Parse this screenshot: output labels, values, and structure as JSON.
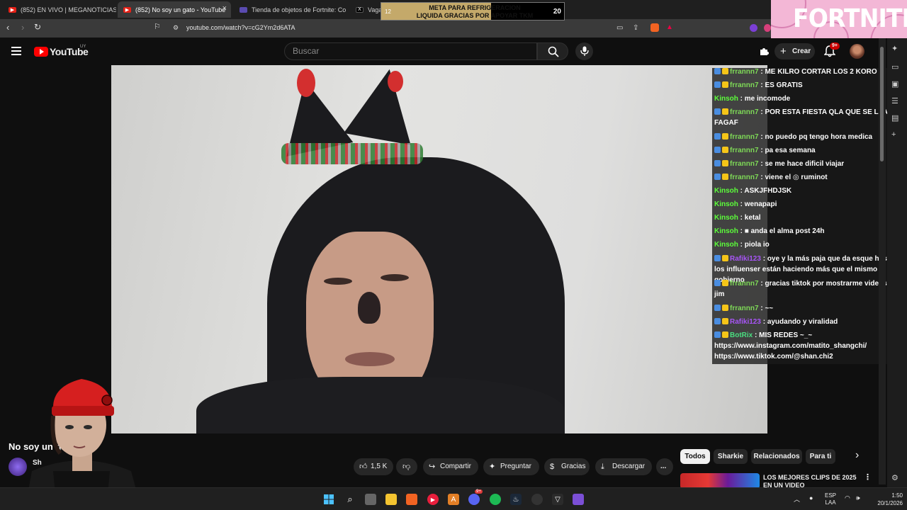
{
  "browser": {
    "tabs": [
      {
        "label": "(852) EN VIVO | MEGANOTICIAS"
      },
      {
        "label": "(852) No soy un gato - YouTube"
      },
      {
        "label": "Tienda de objetos de Fortnite: Conte"
      },
      {
        "label": "Vaga"
      }
    ],
    "tab_close": "×",
    "url": "youtube.com/watch?v=cG2Ym2d6ATA"
  },
  "overlays": {
    "goal": {
      "line1": "META PARA REFRIGERACION",
      "line2": "LIQUIDA GRACIAS POR APOYAR TKM",
      "current": "12",
      "target": "20",
      "progress": 0.6
    },
    "fortnite_logo": "FORTNITE"
  },
  "youtube": {
    "logo": "YouTube",
    "region": "UY",
    "search_placeholder": "Buscar",
    "create_label": "Crear",
    "notifications_count": "9+"
  },
  "chat": {
    "messages": [
      {
        "user": "frrannn7",
        "user_color": "#7ed957",
        "text": "ME KILRO CORTAR LOS 2 KORO"
      },
      {
        "user": "frrannn7",
        "user_color": "#7ed957",
        "text": "ES GRATIS"
      },
      {
        "user": "Kinsoh",
        "user_color": "#5cff3a",
        "text": "me incomode"
      },
      {
        "user": "frrannn7",
        "user_color": "#7ed957",
        "text": "POR ESTA FIESTA QLA QUE SE LLAMA FAGAF"
      },
      {
        "user": "frrannn7",
        "user_color": "#7ed957",
        "text": "no puedo pq tengo hora medica"
      },
      {
        "user": "frrannn7",
        "user_color": "#7ed957",
        "text": "pa esa semana"
      },
      {
        "user": "frrannn7",
        "user_color": "#7ed957",
        "text": "se me hace dificil viajar"
      },
      {
        "user": "frrannn7",
        "user_color": "#7ed957",
        "text": "viene el ◎ ruminot"
      },
      {
        "user": "Kinsoh",
        "user_color": "#5cff3a",
        "text": "ASKJFHDJSK"
      },
      {
        "user": "Kinsoh",
        "user_color": "#5cff3a",
        "text": "wenapapi"
      },
      {
        "user": "Kinsoh",
        "user_color": "#5cff3a",
        "text": "ketal"
      },
      {
        "user": "Kinsoh",
        "user_color": "#5cff3a",
        "text": "■ anda el alma post 24h"
      },
      {
        "user": "Kinsoh",
        "user_color": "#5cff3a",
        "text": "piola io"
      },
      {
        "user": "Rafiki123",
        "user_color": "#a855f7",
        "text": "oye y la más paja que da esque hasta los influenser están haciendo más que el mismo gobierno"
      },
      {
        "user": "frrannn7",
        "user_color": "#7ed957",
        "text": "gracias tiktok por mostrarme videos del jim"
      },
      {
        "user": "frrannn7",
        "user_color": "#7ed957",
        "text": "~~"
      },
      {
        "user": "Rafiki123",
        "user_color": "#a855f7",
        "text": "ayudando y viralidad"
      },
      {
        "user": "BotRix",
        "user_color": "#4ade80",
        "text": "MIS REDES ~_~ https://www.instagram.com/matito_shangchi/ https://www.tiktok.com/@shan.chi2"
      }
    ]
  },
  "video_info": {
    "title": "No soy un gat",
    "channel_initial": "Sh"
  },
  "actions": {
    "likes": "1,5 K",
    "share": "Compartir",
    "ask": "Preguntar",
    "thanks": "Gracias",
    "download": "Descargar",
    "more": "..."
  },
  "chips": [
    {
      "label": "Todos"
    },
    {
      "label": "Sharkie"
    },
    {
      "label": "Relacionados"
    },
    {
      "label": "Para ti"
    }
  ],
  "recommendation": {
    "title": "LOS MEJORES CLIPS DE 2025 EN UN VIDEO"
  },
  "taskbar": {
    "lang": "ESP",
    "layout": "LAA",
    "time": "1:50",
    "date": "20/1/2026",
    "discord_badge": "9+"
  }
}
